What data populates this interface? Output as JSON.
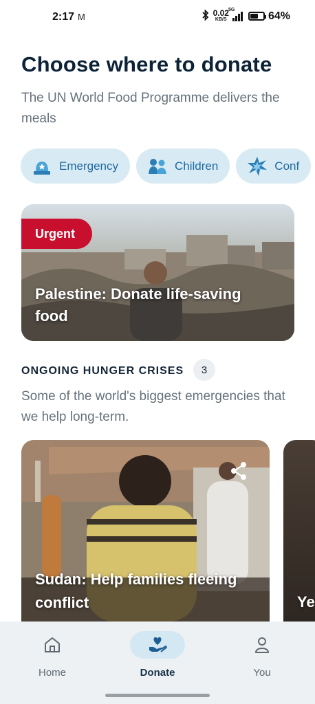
{
  "status_bar": {
    "time": "2:17",
    "mail_icon": "M",
    "bluetooth_icon": "bluetooth-icon",
    "net_speed_value": "0.02",
    "net_speed_unit": "KB/S",
    "network_type": "5G",
    "battery_percent": "64%",
    "battery_level": 0.64
  },
  "header": {
    "title": "Choose where to donate",
    "subtitle": "The UN World Food Programme delivers the meals"
  },
  "chips": [
    {
      "label": "Emergency",
      "icon": "emergency-icon"
    },
    {
      "label": "Children",
      "icon": "children-icon"
    },
    {
      "label": "Conf",
      "icon": "conflict-icon"
    }
  ],
  "urgent_card": {
    "badge": "Urgent",
    "title": "Palestine: Donate life-saving food"
  },
  "ongoing": {
    "title": "ONGOING HUNGER CRISES",
    "count": "3",
    "description": "Some of the world's biggest emergencies that we help long-term."
  },
  "crisis_cards": [
    {
      "title": "Sudan: Help families fleeing conflict",
      "share_icon": "share-icon"
    },
    {
      "title": "Ye"
    }
  ],
  "bottom_nav": {
    "items": [
      {
        "label": "Home",
        "icon": "home-icon"
      },
      {
        "label": "Donate",
        "icon": "donate-heart-hand-icon",
        "active": true
      },
      {
        "label": "You",
        "icon": "user-icon"
      }
    ]
  },
  "colors": {
    "accent": "#1e6aa0",
    "chip_bg": "#d8eaf3",
    "urgent": "#c8102e",
    "title": "#0c2236",
    "subtle_text": "#66727c"
  }
}
